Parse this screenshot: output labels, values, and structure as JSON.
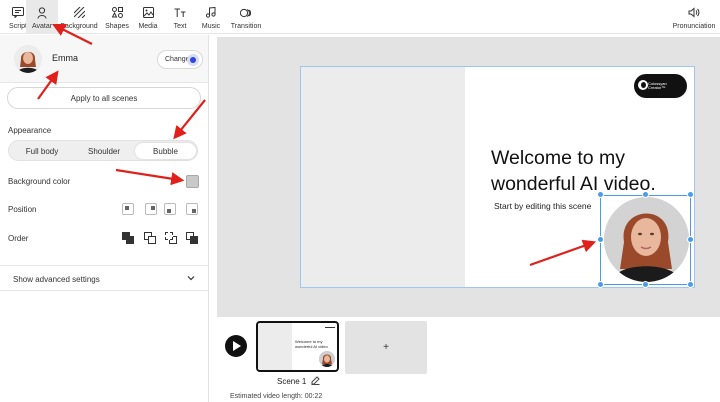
{
  "toolbar": {
    "tools": [
      {
        "label": "Script",
        "icon": "script-icon"
      },
      {
        "label": "Avatar",
        "icon": "avatar-icon"
      },
      {
        "label": "Background",
        "icon": "background-icon"
      },
      {
        "label": "Shapes",
        "icon": "shapes-icon"
      },
      {
        "label": "Media",
        "icon": "media-icon"
      },
      {
        "label": "Text",
        "icon": "text-icon"
      },
      {
        "label": "Music",
        "icon": "music-icon"
      },
      {
        "label": "Transition",
        "icon": "transition-icon"
      }
    ],
    "active_tool": "Avatar",
    "pronunciation_label": "Pronunciation"
  },
  "panel": {
    "avatar_name": "Emma",
    "change_label": "Change",
    "apply_label": "Apply to all scenes",
    "appearance_label": "Appearance",
    "appearance_options": [
      "Full body",
      "Shoulder",
      "Bubble"
    ],
    "appearance_selected": "Bubble",
    "background_color_label": "Background color",
    "background_color": "#c9c9c9",
    "position_label": "Position",
    "order_label": "Order",
    "advanced_label": "Show advanced settings"
  },
  "slide": {
    "logo_text_line1": "Colossyan",
    "logo_text_line2": "Creator™",
    "headline_line1": "Welcome to my",
    "headline_line2": "wonderful AI video.",
    "subline": "Start by editing this scene"
  },
  "timeline": {
    "thumb_text": "Welcome to my wonderful AI video",
    "add_label": "+",
    "scene_label": "Scene 1",
    "estimate": "Estimated video length: 00:22"
  },
  "colors": {
    "accent": "#3046d8",
    "selection": "#4a9ce8",
    "annotation_arrow": "#e0201b"
  }
}
